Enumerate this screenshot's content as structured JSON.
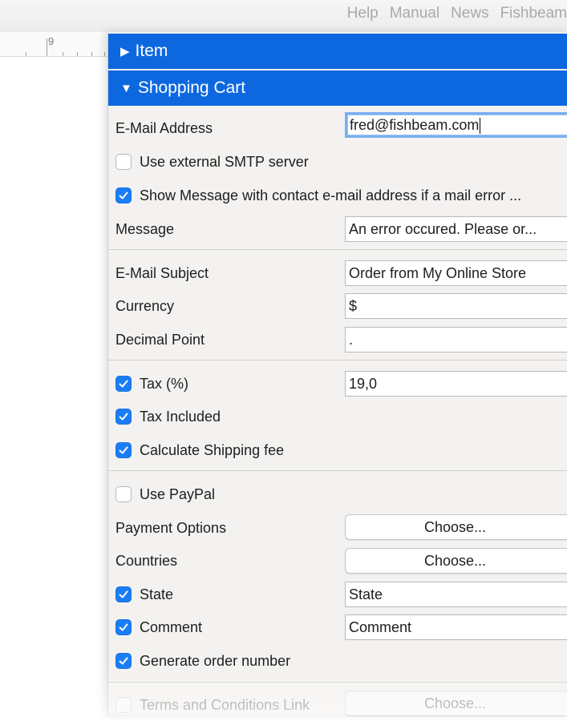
{
  "menubar": {
    "items": [
      "Help",
      "Manual",
      "News",
      "Fishbeam"
    ]
  },
  "ruler": {
    "number": "9"
  },
  "sections": {
    "item": {
      "title": "Item",
      "expanded": false
    },
    "shopping_cart": {
      "title": "Shopping Cart",
      "expanded": true
    }
  },
  "form": {
    "email_label": "E-Mail Address",
    "email_value": "fred@fishbeam.com",
    "smtp_label": "Use external SMTP server",
    "smtp_checked": false,
    "show_message_label": "Show Message with contact e-mail address if a mail error ...",
    "show_message_checked": true,
    "message_label": "Message",
    "message_value": "An error occured. Please or...",
    "subject_label": "E-Mail Subject",
    "subject_value": "Order from My Online Store",
    "currency_label": "Currency",
    "currency_value": "$",
    "decimal_label": "Decimal Point",
    "decimal_value": ".",
    "tax_label": "Tax (%)",
    "tax_checked": true,
    "tax_value": "19,0",
    "tax_included_label": "Tax Included",
    "tax_included_checked": true,
    "shipping_label": "Calculate Shipping fee",
    "shipping_checked": true,
    "paypal_label": "Use PayPal",
    "paypal_checked": false,
    "payment_label": "Payment Options",
    "payment_button": "Choose...",
    "countries_label": "Countries",
    "countries_button": "Choose...",
    "state_label": "State",
    "state_checked": true,
    "state_value": "State",
    "comment_label": "Comment",
    "comment_checked": true,
    "comment_value": "Comment",
    "order_number_label": "Generate order number",
    "order_number_checked": true,
    "terms_label": "Terms and Conditions Link",
    "terms_checked": false,
    "terms_button": "Choose..."
  },
  "colors": {
    "accent": "#0d68e0",
    "checkbox": "#1a7df5",
    "panel_bg": "#f4f2f0"
  }
}
